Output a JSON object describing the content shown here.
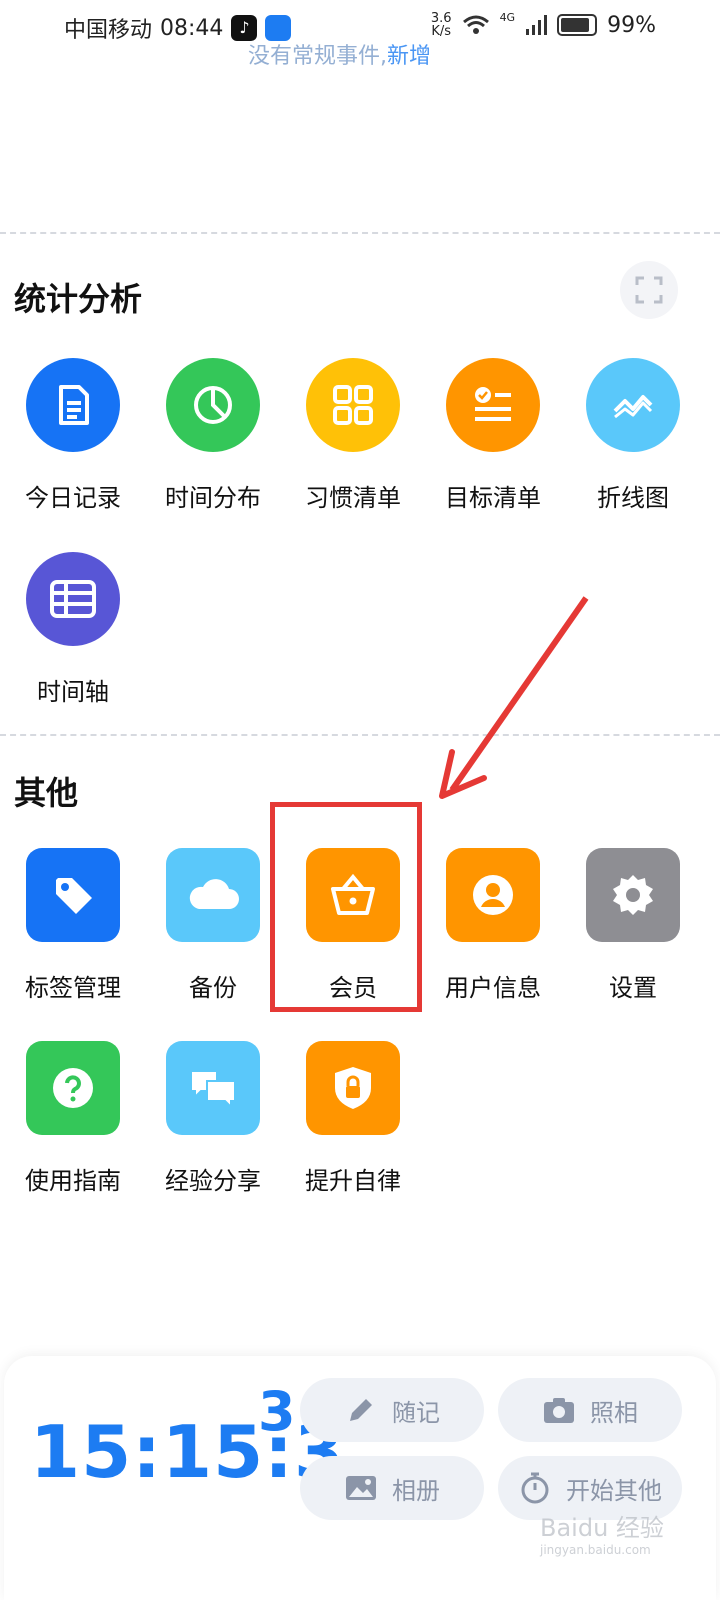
{
  "status_bar": {
    "carrier": "中国移动",
    "time": "08:44",
    "net_speed_value": "3.6",
    "net_speed_unit": "K/s",
    "network": "4G",
    "battery": "99%"
  },
  "top_hint": {
    "text": "没有常规事件,",
    "link": "新增"
  },
  "stats_section": {
    "title": "统计分析",
    "items": [
      {
        "label": "今日记录",
        "icon": "document-icon",
        "color": "#1673f5"
      },
      {
        "label": "时间分布",
        "icon": "pie-chart-icon",
        "color": "#34c759"
      },
      {
        "label": "习惯清单",
        "icon": "grid-icon",
        "color": "#ffc107"
      },
      {
        "label": "目标清单",
        "icon": "checklist-icon",
        "color": "#ff9500"
      },
      {
        "label": "折线图",
        "icon": "line-chart-icon",
        "color": "#5ac8fa"
      },
      {
        "label": "时间轴",
        "icon": "table-icon",
        "color": "#5856d6"
      }
    ]
  },
  "other_section": {
    "title": "其他",
    "items": [
      {
        "label": "标签管理",
        "icon": "tag-icon",
        "color": "#1673f5"
      },
      {
        "label": "备份",
        "icon": "cloud-icon",
        "color": "#5ac8fa"
      },
      {
        "label": "会员",
        "icon": "basket-icon",
        "color": "#ff9500"
      },
      {
        "label": "用户信息",
        "icon": "user-icon",
        "color": "#ff9500"
      },
      {
        "label": "设置",
        "icon": "gear-icon",
        "color": "#8e8e93"
      },
      {
        "label": "使用指南",
        "icon": "help-icon",
        "color": "#34c759"
      },
      {
        "label": "经验分享",
        "icon": "chat-icon",
        "color": "#5ac8fa"
      },
      {
        "label": "提升自律",
        "icon": "shield-lock-icon",
        "color": "#ff9500"
      }
    ]
  },
  "bottom_panel": {
    "clock_main": "15:15:3",
    "clock_sup": "3",
    "actions": [
      {
        "label": "随记",
        "icon": "pencil-icon"
      },
      {
        "label": "照相",
        "icon": "camera-icon"
      },
      {
        "label": "相册",
        "icon": "image-icon"
      },
      {
        "label": "开始其他",
        "icon": "stopwatch-icon"
      }
    ]
  },
  "watermark": {
    "text": "Baidu 经验",
    "sub": "jingyan.baidu.com"
  }
}
